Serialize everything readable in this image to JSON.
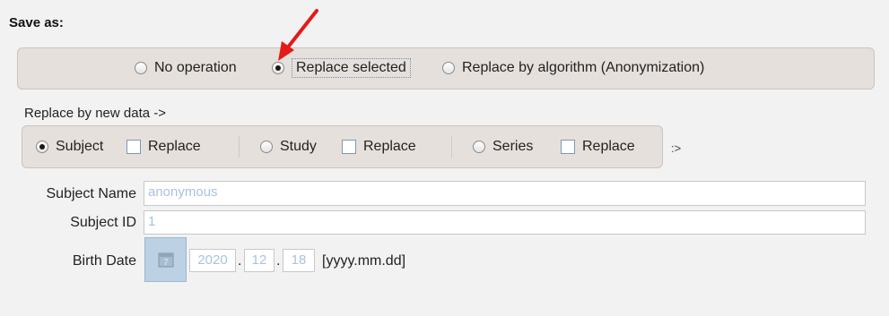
{
  "title": "Save as:",
  "operations": {
    "options": [
      {
        "label": "No operation",
        "selected": false
      },
      {
        "label": "Replace selected",
        "selected": true
      },
      {
        "label": "Replace by algorithm (Anonymization)",
        "selected": false
      }
    ]
  },
  "replace_label": "Replace by new data ->",
  "levels": {
    "subject": {
      "label": "Subject",
      "selected": true,
      "replace_label": "Replace",
      "replace_checked": false
    },
    "study": {
      "label": "Study",
      "selected": false,
      "replace_label": "Replace",
      "replace_checked": false
    },
    "series": {
      "label": "Series",
      "selected": false,
      "replace_label": "Replace",
      "replace_checked": false
    },
    "tail": ":>"
  },
  "fields": {
    "subject_name": {
      "label": "Subject Name",
      "value": "anonymous"
    },
    "subject_id": {
      "label": "Subject ID",
      "value": "1"
    },
    "birth_date": {
      "label": "Birth Date",
      "year": "2020",
      "month": "12",
      "day": "18",
      "format": "[yyyy.mm.dd]",
      "sep": "."
    }
  },
  "annotation": {
    "color": "#e21b1b"
  },
  "icons": {
    "calendar": "calendar-icon"
  }
}
